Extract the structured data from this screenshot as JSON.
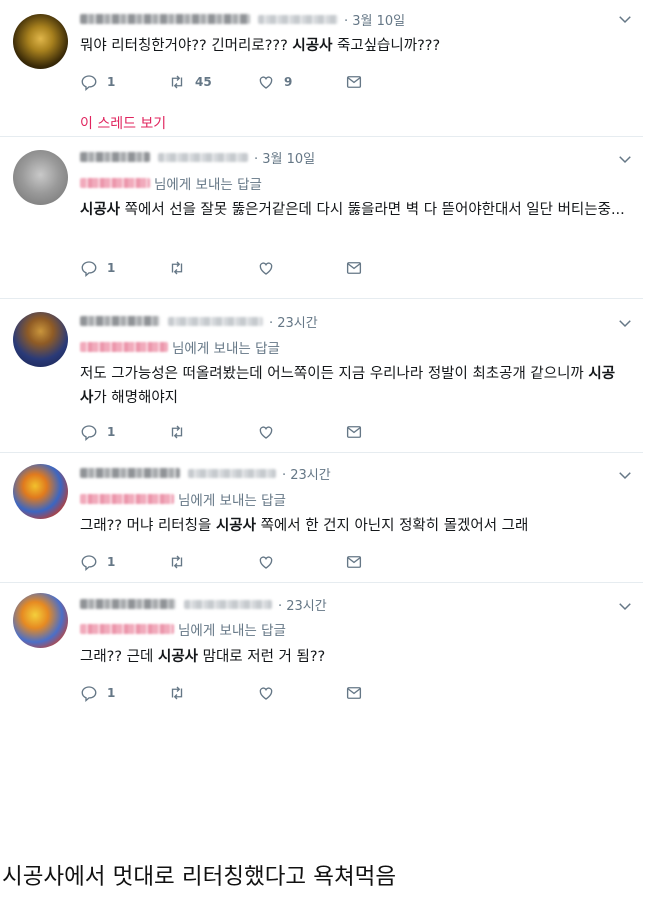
{
  "tweets": [
    {
      "name": "구원의 밤 하는사람",
      "handle": "@w****43",
      "time": "· 3월 10일",
      "reply_to": "",
      "reply_suffix": "",
      "body": [
        {
          "t": "뭐야 리터칭한거야?? 긴머리로??? "
        },
        {
          "t": "시공사",
          "b": true
        },
        {
          "t": " 죽고싶습니까???"
        }
      ],
      "replies": "1",
      "retweets": "45",
      "likes": "9",
      "thread_link": "이 스레드 보기"
    },
    {
      "name": "■■■■■■",
      "handle": "@b****ng_yo",
      "time": "· 3월 10일",
      "reply_to": "@****y_89",
      "reply_suffix": "님에게 보내는 답글",
      "body": [
        {
          "t": "시공사",
          "b": true
        },
        {
          "t": " 쪽에서 선을 잘못 뚫은거같은데 다시 뚫을라면 벽 다 뜯어야한대서 일단 버티는중..."
        }
      ],
      "replies": "1",
      "retweets": "",
      "likes": ""
    },
    {
      "name": "■■ ■■ ■",
      "handle": "@p****d_****",
      "time": "· 23시간",
      "reply_to": "@g****_b***",
      "reply_suffix": "님에게 보내는 답글",
      "body": [
        {
          "t": "저도 그가능성은 떠올려봤는데 어느쪽이든 지금 우리나라 정발이 최초공개 같으니까 "
        },
        {
          "t": "시공사",
          "b": true
        },
        {
          "t": "가 해명해야지"
        }
      ],
      "replies": "1",
      "retweets": "",
      "likes": ""
    },
    {
      "name": "■■■ ■■",
      "handle": "@b****r_****",
      "time": "· 23시간",
      "reply_to": "@****a***",
      "reply_suffix": "님에게 보내는 답글",
      "body": [
        {
          "t": "그래?? 머냐 리터칭을 "
        },
        {
          "t": "시공사",
          "b": true
        },
        {
          "t": " 쪽에서 한 건지 아닌지 정확히 몰겠어서 그래"
        }
      ],
      "replies": "1",
      "retweets": "",
      "likes": ""
    },
    {
      "name": "■■■■ ■■",
      "handle": "@b****r_****",
      "time": "· 23시간",
      "reply_to": "@****b***",
      "reply_suffix": "님에게 보내는 답글",
      "body": [
        {
          "t": "그래?? 근데 "
        },
        {
          "t": "시공사",
          "b": true
        },
        {
          "t": " 맘대로 저런 거 됨??"
        }
      ],
      "replies": "1",
      "retweets": "",
      "likes": ""
    }
  ],
  "caption": "시공사에서 멋대로 리터칭했다고 욕쳐먹음",
  "colors": {
    "muted": "#657786",
    "link": "#e0245e",
    "divider": "#e6ecf0"
  },
  "icons": [
    "chevron-down-icon",
    "reply-icon",
    "retweet-icon",
    "like-icon",
    "dm-icon"
  ]
}
